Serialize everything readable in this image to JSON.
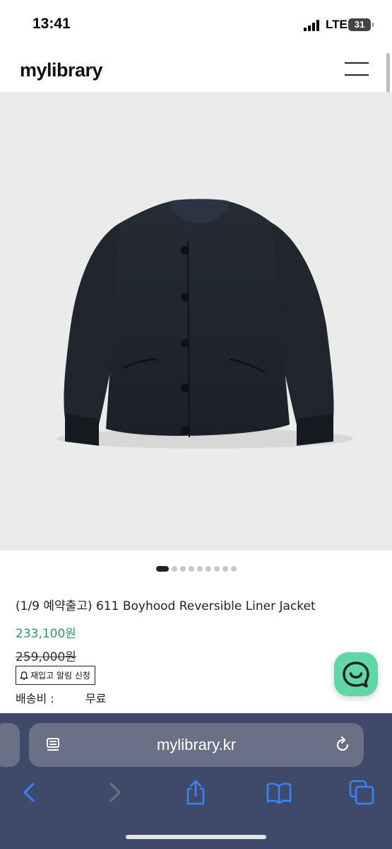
{
  "status_bar": {
    "time": "13:41",
    "network": "LTE",
    "battery": "31"
  },
  "header": {
    "logo": "mylibrary",
    "menu_icon": "hamburger-icon"
  },
  "product": {
    "image_alt": "navy reversible liner jacket",
    "carousel": {
      "count": 9,
      "active": 0
    },
    "title": "(1/9 예약출고) 611 Boyhood Reversible Liner Jacket",
    "sale_price": "233,100원",
    "original_price": "259,000원",
    "restock_button": "재입고 알림 신청",
    "shipping_label": "배송비 :",
    "shipping_value": "무료"
  },
  "chat_button": {
    "icon": "chat-smile-icon"
  },
  "browser": {
    "url": "mylibrary.kr",
    "icons": [
      "reader-icon",
      "reload-icon",
      "back-icon",
      "forward-icon",
      "share-icon",
      "bookmarks-icon",
      "tabs-icon"
    ]
  },
  "colors": {
    "sale_price": "#2e9a5a",
    "chat_button": "#5fd7a7",
    "toolbar": "#3f4a6b",
    "toolbar_icon": "#3b82f6"
  }
}
